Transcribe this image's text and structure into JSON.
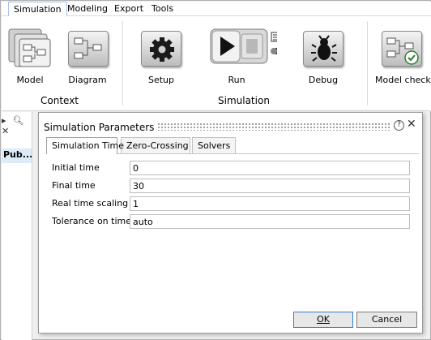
{
  "menu": {
    "items": [
      "Simulation",
      "Modeling",
      "Export",
      "Tools"
    ]
  },
  "ribbon": {
    "buttons": {
      "model": "Model",
      "diagram": "Diagram",
      "setup": "Setup",
      "run": "Run",
      "debug": "Debug",
      "model_check": "Model check"
    },
    "groups": {
      "context": "Context",
      "simulation": "Simulation"
    }
  },
  "left_panel": {
    "selected_item": "Pub..."
  },
  "dialog": {
    "title": "Simulation Parameters",
    "help": "?",
    "tabs": [
      "Simulation Time",
      "Zero-Crossing",
      "Solvers"
    ],
    "fields": [
      {
        "label": "Initial time",
        "value": "0"
      },
      {
        "label": "Final time",
        "value": "30"
      },
      {
        "label": "Real time scaling",
        "value": "1"
      },
      {
        "label": "Tolerance on time",
        "value": "auto"
      }
    ],
    "ok_label": "OK",
    "cancel_label": "Cancel"
  }
}
